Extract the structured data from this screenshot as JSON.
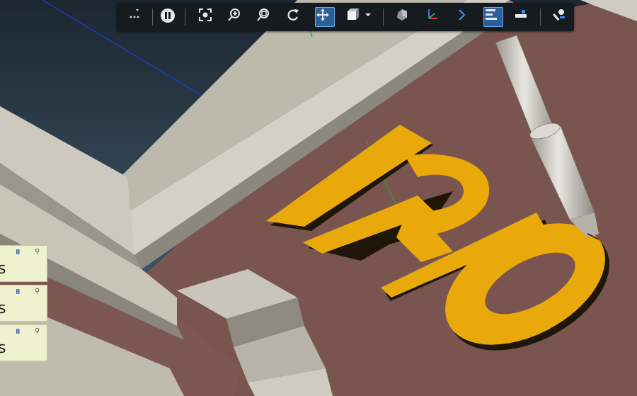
{
  "scene": {
    "engraved_text": "RIO",
    "colors": {
      "background_top": "#202c36",
      "background_bottom": "#4a6478",
      "table_surface": "#7a5550",
      "frame": "#c8c4b8",
      "frame_shadow": "#8a867c",
      "letters": "#e9a90b",
      "letters_shadow": "#1a1204",
      "tool": "#d4d1ca"
    }
  },
  "toolbar": {
    "buttons": [
      {
        "name": "more-options",
        "icon": "more-icon"
      },
      {
        "name": "pause-simulation",
        "icon": "pause-icon"
      },
      {
        "name": "fit-view",
        "icon": "fit-view-icon"
      },
      {
        "name": "zoom",
        "icon": "zoom-icon"
      },
      {
        "name": "zoom-window",
        "icon": "zoom-window-icon"
      },
      {
        "name": "rotate-view",
        "icon": "rotate-icon"
      },
      {
        "name": "pan-view",
        "icon": "pan-icon",
        "active": true
      },
      {
        "name": "view-cube",
        "icon": "view-cube-icon"
      },
      {
        "name": "shading",
        "icon": "shading-icon"
      },
      {
        "name": "coordinate-frame",
        "icon": "axes-icon"
      },
      {
        "name": "next",
        "icon": "chevron-right-icon"
      },
      {
        "name": "align",
        "icon": "align-icon",
        "active": true
      },
      {
        "name": "measure",
        "icon": "measure-icon"
      },
      {
        "name": "settings",
        "icon": "tools-icon"
      }
    ]
  },
  "side_panels": [
    {
      "pause": "II",
      "pin": "⚲",
      "label": "s"
    },
    {
      "pause": "II",
      "pin": "⚲",
      "label": "s"
    },
    {
      "pause": "II",
      "pin": "⚲",
      "label": "s"
    }
  ]
}
